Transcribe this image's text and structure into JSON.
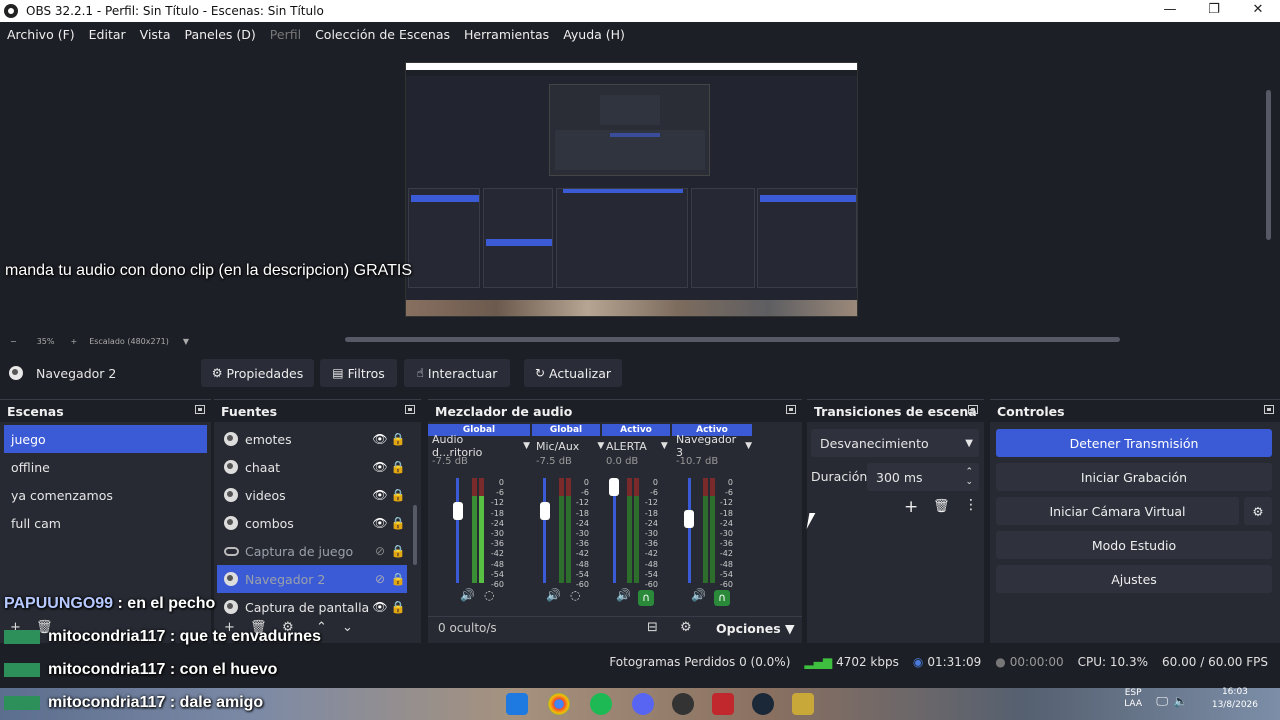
{
  "window": {
    "title": "OBS 32.2.1 - Perfil: Sin Título - Escenas: Sin Título"
  },
  "menu": [
    {
      "label": "Archivo (F)",
      "enabled": true
    },
    {
      "label": "Editar",
      "enabled": true
    },
    {
      "label": "Vista",
      "enabled": true
    },
    {
      "label": "Paneles (D)",
      "enabled": true
    },
    {
      "label": "Perfil",
      "enabled": false
    },
    {
      "label": "Colección de Escenas",
      "enabled": true
    },
    {
      "label": "Herramientas",
      "enabled": true
    },
    {
      "label": "Ayuda (H)",
      "enabled": true
    }
  ],
  "preview": {
    "overlay_text": "manda tu audio con dono clip (en la descripcion) GRATIS",
    "zoom": "35%",
    "scaling": "Escalado (480x271)"
  },
  "source_bar": {
    "selected_source": "Navegador 2",
    "buttons": {
      "properties": "Propiedades",
      "filters": "Filtros",
      "interact": "Interactuar",
      "refresh": "Actualizar"
    }
  },
  "scenes": {
    "title": "Escenas",
    "items": [
      "juego",
      "offline",
      "ya comenzamos",
      "full cam"
    ],
    "selected": 0
  },
  "sources": {
    "title": "Fuentes",
    "items": [
      {
        "name": "emotes",
        "type": "browser",
        "visible": true
      },
      {
        "name": "chaat",
        "type": "browser",
        "visible": true
      },
      {
        "name": "videos",
        "type": "browser",
        "visible": true
      },
      {
        "name": "combos",
        "type": "browser",
        "visible": true
      },
      {
        "name": "Captura de juego",
        "type": "game",
        "visible": false
      },
      {
        "name": "Navegador 2",
        "type": "browser",
        "visible": false,
        "selected": true
      },
      {
        "name": "Captura de pantalla",
        "type": "browser",
        "visible": true
      }
    ]
  },
  "mixer": {
    "title": "Mezclador de audio",
    "channels": [
      {
        "header": "Global",
        "name": "Audio d...ritorio",
        "db": "-7.5 dB"
      },
      {
        "header": "Global",
        "name": "Mic/Aux",
        "db": "-7.5 dB"
      },
      {
        "header": "Activo",
        "name": "ALERTA",
        "db": "0.0 dB"
      },
      {
        "header": "Activo",
        "name": "Navegador 3",
        "db": "-10.7 dB"
      }
    ],
    "scale": [
      "0",
      "-6",
      "-12",
      "-18",
      "-24",
      "-30",
      "-36",
      "-42",
      "-48",
      "-54",
      "-60"
    ],
    "hidden": "0 oculto/s",
    "options": "Opciones"
  },
  "transitions": {
    "title": "Transiciones de escena",
    "type": "Desvanecimiento",
    "duration_label": "Duración",
    "duration_value": "300 ms"
  },
  "controls": {
    "title": "Controles",
    "stop_stream": "Detener Transmisión",
    "start_record": "Iniciar Grabación",
    "virtual_cam": "Iniciar Cámara Virtual",
    "studio_mode": "Modo Estudio",
    "settings": "Ajustes"
  },
  "status": {
    "dropped": "Fotogramas Perdidos 0 (0.0%)",
    "bitrate": "4702 kbps",
    "stream_time": "01:31:09",
    "rec_time": "00:00:00",
    "cpu": "CPU: 10.3%",
    "fps": "60.00 / 60.00 FPS"
  },
  "chat": [
    {
      "user": "PAPUUNGO99",
      "text": ": en el pecho"
    },
    {
      "user": "mitocondria117",
      "text": ": que te envadurnes"
    },
    {
      "user": "mitocondria117",
      "text": ": con el huevo"
    },
    {
      "user": "mitocondria117",
      "text": ": dale amigo"
    }
  ],
  "taskbar": {
    "lang": "ESP",
    "lang2": "LAA",
    "time": "16:03",
    "date": "13/8/2026"
  },
  "colors": {
    "accent": "#3b5bd6",
    "bg": "#1d1f26",
    "dock": "#272a33"
  }
}
